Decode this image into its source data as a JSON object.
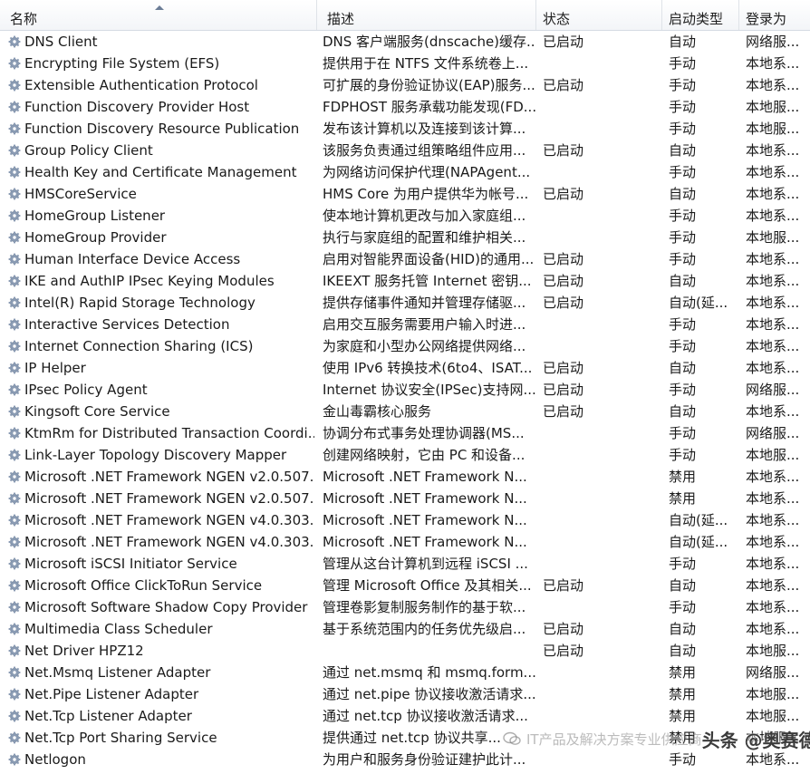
{
  "columns": {
    "name": "名称",
    "description": "描述",
    "status": "状态",
    "startup_type": "启动类型",
    "logon_as": "登录为"
  },
  "services": [
    {
      "name": "DNS Client",
      "description": "DNS 客户端服务(dnscache)缓存...",
      "status": "已启动",
      "startup": "自动",
      "logon": "网络服..."
    },
    {
      "name": "Encrypting File System (EFS)",
      "description": "提供用于在 NTFS 文件系统卷上...",
      "status": "",
      "startup": "手动",
      "logon": "本地系..."
    },
    {
      "name": "Extensible Authentication Protocol",
      "description": "可扩展的身份验证协议(EAP)服务...",
      "status": "已启动",
      "startup": "手动",
      "logon": "本地系..."
    },
    {
      "name": "Function Discovery Provider Host",
      "description": "FDPHOST 服务承载功能发现(FD...",
      "status": "",
      "startup": "手动",
      "logon": "本地服..."
    },
    {
      "name": "Function Discovery Resource Publication",
      "description": "发布该计算机以及连接到该计算...",
      "status": "",
      "startup": "手动",
      "logon": "本地服..."
    },
    {
      "name": "Group Policy Client",
      "description": "该服务负责通过组策略组件应用...",
      "status": "已启动",
      "startup": "自动",
      "logon": "本地系..."
    },
    {
      "name": "Health Key and Certificate Management",
      "description": "为网络访问保护代理(NAPAgent...",
      "status": "",
      "startup": "手动",
      "logon": "本地系..."
    },
    {
      "name": "HMSCoreService",
      "description": "HMS Core 为用户提供华为帐号...",
      "status": "已启动",
      "startup": "自动",
      "logon": "本地系..."
    },
    {
      "name": "HomeGroup Listener",
      "description": "使本地计算机更改与加入家庭组...",
      "status": "",
      "startup": "手动",
      "logon": "本地系..."
    },
    {
      "name": "HomeGroup Provider",
      "description": "执行与家庭组的配置和维护相关...",
      "status": "",
      "startup": "手动",
      "logon": "本地服..."
    },
    {
      "name": "Human Interface Device Access",
      "description": "启用对智能界面设备(HID)的通用...",
      "status": "已启动",
      "startup": "手动",
      "logon": "本地系..."
    },
    {
      "name": "IKE and AuthIP IPsec Keying Modules",
      "description": "IKEEXT 服务托管 Internet 密钥...",
      "status": "已启动",
      "startup": "自动",
      "logon": "本地系..."
    },
    {
      "name": "Intel(R) Rapid Storage Technology",
      "description": "提供存储事件通知并管理存储驱...",
      "status": "已启动",
      "startup": "自动(延...",
      "logon": "本地系..."
    },
    {
      "name": "Interactive Services Detection",
      "description": "启用交互服务需要用户输入时进...",
      "status": "",
      "startup": "手动",
      "logon": "本地系..."
    },
    {
      "name": "Internet Connection Sharing (ICS)",
      "description": "为家庭和小型办公网络提供网络...",
      "status": "",
      "startup": "手动",
      "logon": "本地系..."
    },
    {
      "name": "IP Helper",
      "description": "使用 IPv6 转换技术(6to4、ISAT...",
      "status": "已启动",
      "startup": "自动",
      "logon": "本地系..."
    },
    {
      "name": "IPsec Policy Agent",
      "description": "Internet 协议安全(IPSec)支持网...",
      "status": "已启动",
      "startup": "手动",
      "logon": "网络服..."
    },
    {
      "name": "Kingsoft Core Service",
      "description": "金山毒霸核心服务",
      "status": "已启动",
      "startup": "自动",
      "logon": "本地系..."
    },
    {
      "name": "KtmRm for Distributed Transaction Coordi...",
      "description": "协调分布式事务处理协调器(MS...",
      "status": "",
      "startup": "手动",
      "logon": "网络服..."
    },
    {
      "name": "Link-Layer Topology Discovery Mapper",
      "description": "创建网络映射，它由 PC 和设备...",
      "status": "",
      "startup": "手动",
      "logon": "本地服..."
    },
    {
      "name": "Microsoft .NET Framework NGEN v2.0.507...",
      "description": "Microsoft .NET Framework N...",
      "status": "",
      "startup": "禁用",
      "logon": "本地系..."
    },
    {
      "name": "Microsoft .NET Framework NGEN v2.0.507...",
      "description": "Microsoft .NET Framework N...",
      "status": "",
      "startup": "禁用",
      "logon": "本地系..."
    },
    {
      "name": "Microsoft .NET Framework NGEN v4.0.303...",
      "description": "Microsoft .NET Framework N...",
      "status": "",
      "startup": "自动(延...",
      "logon": "本地系..."
    },
    {
      "name": "Microsoft .NET Framework NGEN v4.0.303...",
      "description": "Microsoft .NET Framework N...",
      "status": "",
      "startup": "自动(延...",
      "logon": "本地系..."
    },
    {
      "name": "Microsoft iSCSI Initiator Service",
      "description": "管理从这台计算机到远程 iSCSI ...",
      "status": "",
      "startup": "手动",
      "logon": "本地系..."
    },
    {
      "name": "Microsoft Office ClickToRun Service",
      "description": "管理 Microsoft Office 及其相关...",
      "status": "已启动",
      "startup": "自动",
      "logon": "本地系..."
    },
    {
      "name": "Microsoft Software Shadow Copy Provider",
      "description": "管理卷影复制服务制作的基于软...",
      "status": "",
      "startup": "手动",
      "logon": "本地系..."
    },
    {
      "name": "Multimedia Class Scheduler",
      "description": "基于系统范围内的任务优先级启...",
      "status": "已启动",
      "startup": "自动",
      "logon": "本地系..."
    },
    {
      "name": "Net Driver HPZ12",
      "description": "",
      "status": "已启动",
      "startup": "自动",
      "logon": "本地服..."
    },
    {
      "name": "Net.Msmq Listener Adapter",
      "description": "通过 net.msmq 和 msmq.form...",
      "status": "",
      "startup": "禁用",
      "logon": "网络服..."
    },
    {
      "name": "Net.Pipe Listener Adapter",
      "description": "通过 net.pipe 协议接收激活请求...",
      "status": "",
      "startup": "禁用",
      "logon": "本地服..."
    },
    {
      "name": "Net.Tcp Listener Adapter",
      "description": "通过 net.tcp 协议接收激活请求...",
      "status": "",
      "startup": "禁用",
      "logon": "本地服..."
    },
    {
      "name": "Net.Tcp Port Sharing Service",
      "description": "提供通过 net.tcp 协议共享...",
      "status": "",
      "startup": "禁用",
      "logon": "本地服..."
    },
    {
      "name": "Netlogon",
      "description": "为用户和服务身份验证建护此计...",
      "status": "",
      "startup": "手动",
      "logon": "本地系..."
    }
  ],
  "watermark": {
    "sub": "IT产品及解决方案专业供应商",
    "main": "头条 @奥赛德邢老师"
  },
  "icons": {
    "row_icon": "gear-icon",
    "sort_indicator": "sort-ascending-icon",
    "watermark_icon": "wechat-bubble-icon"
  },
  "colors": {
    "gear_fill": "#8a9bb3",
    "gear_stroke": "#5d6f88",
    "header_border": "#d5dbe3"
  }
}
